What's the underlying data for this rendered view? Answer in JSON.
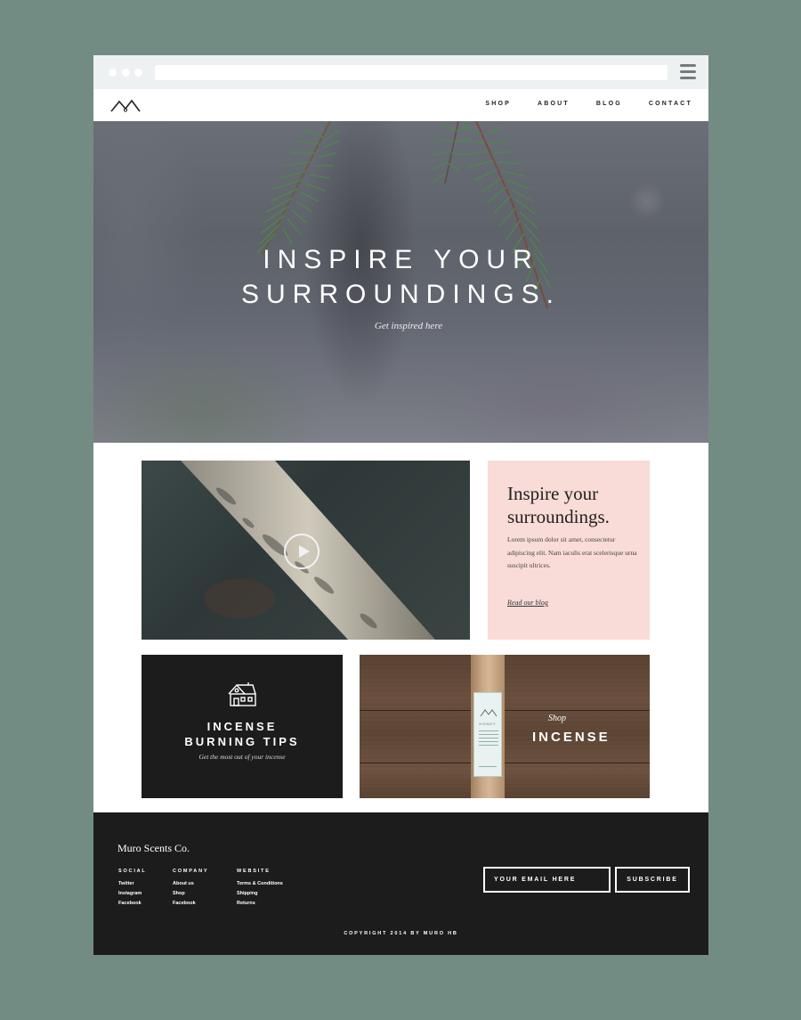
{
  "browser": {
    "url": ""
  },
  "nav": {
    "logo_icon": "mountain-logo-icon",
    "links": [
      "SHOP",
      "ABOUT",
      "BLOG",
      "CONTACT"
    ]
  },
  "hero": {
    "title_line1": "INSPIRE YOUR",
    "title_line2": "SURROUNDINGS.",
    "subtitle": "Get inspired here"
  },
  "video": {
    "icon": "play-icon"
  },
  "blog_card": {
    "title": "Inspire your surroundings.",
    "body": "Lorem ipsum dolor sit amet, consectetur adipiscing elit. Nam iaculis erat scelerisque urna suscipit ultrices.",
    "link": "Read our blog",
    "background": "#f9dbd7"
  },
  "tips_card": {
    "icon": "house-icon",
    "title_line1": "INCENSE",
    "title_line2": "BURNING TIPS",
    "subtitle": "Get the most out of your incense",
    "background": "#1d1c1d"
  },
  "shop_card": {
    "small": "Shop",
    "big": "INCENSE",
    "product_label": "HONEY"
  },
  "footer": {
    "brand": "Muro Scents Co.",
    "columns": [
      {
        "heading": "SOCIAL",
        "links": [
          "Twitter",
          "Instagram",
          "Facebook"
        ]
      },
      {
        "heading": "COMPANY",
        "links": [
          "About us",
          "Shop",
          "Facebook"
        ]
      },
      {
        "heading": "WEBSITE",
        "links": [
          "Terms & Conditions",
          "Shipping",
          "Returns"
        ]
      }
    ],
    "email_placeholder": "YOUR EMAIL HERE",
    "subscribe_label": "SUBSCRIBE",
    "copyright": "COPYRIGHT 2014 BY MURO HB"
  },
  "colors": {
    "page_background": "#728c83",
    "footer": "#1d1c1d",
    "accent_pink": "#f9dbd7"
  }
}
